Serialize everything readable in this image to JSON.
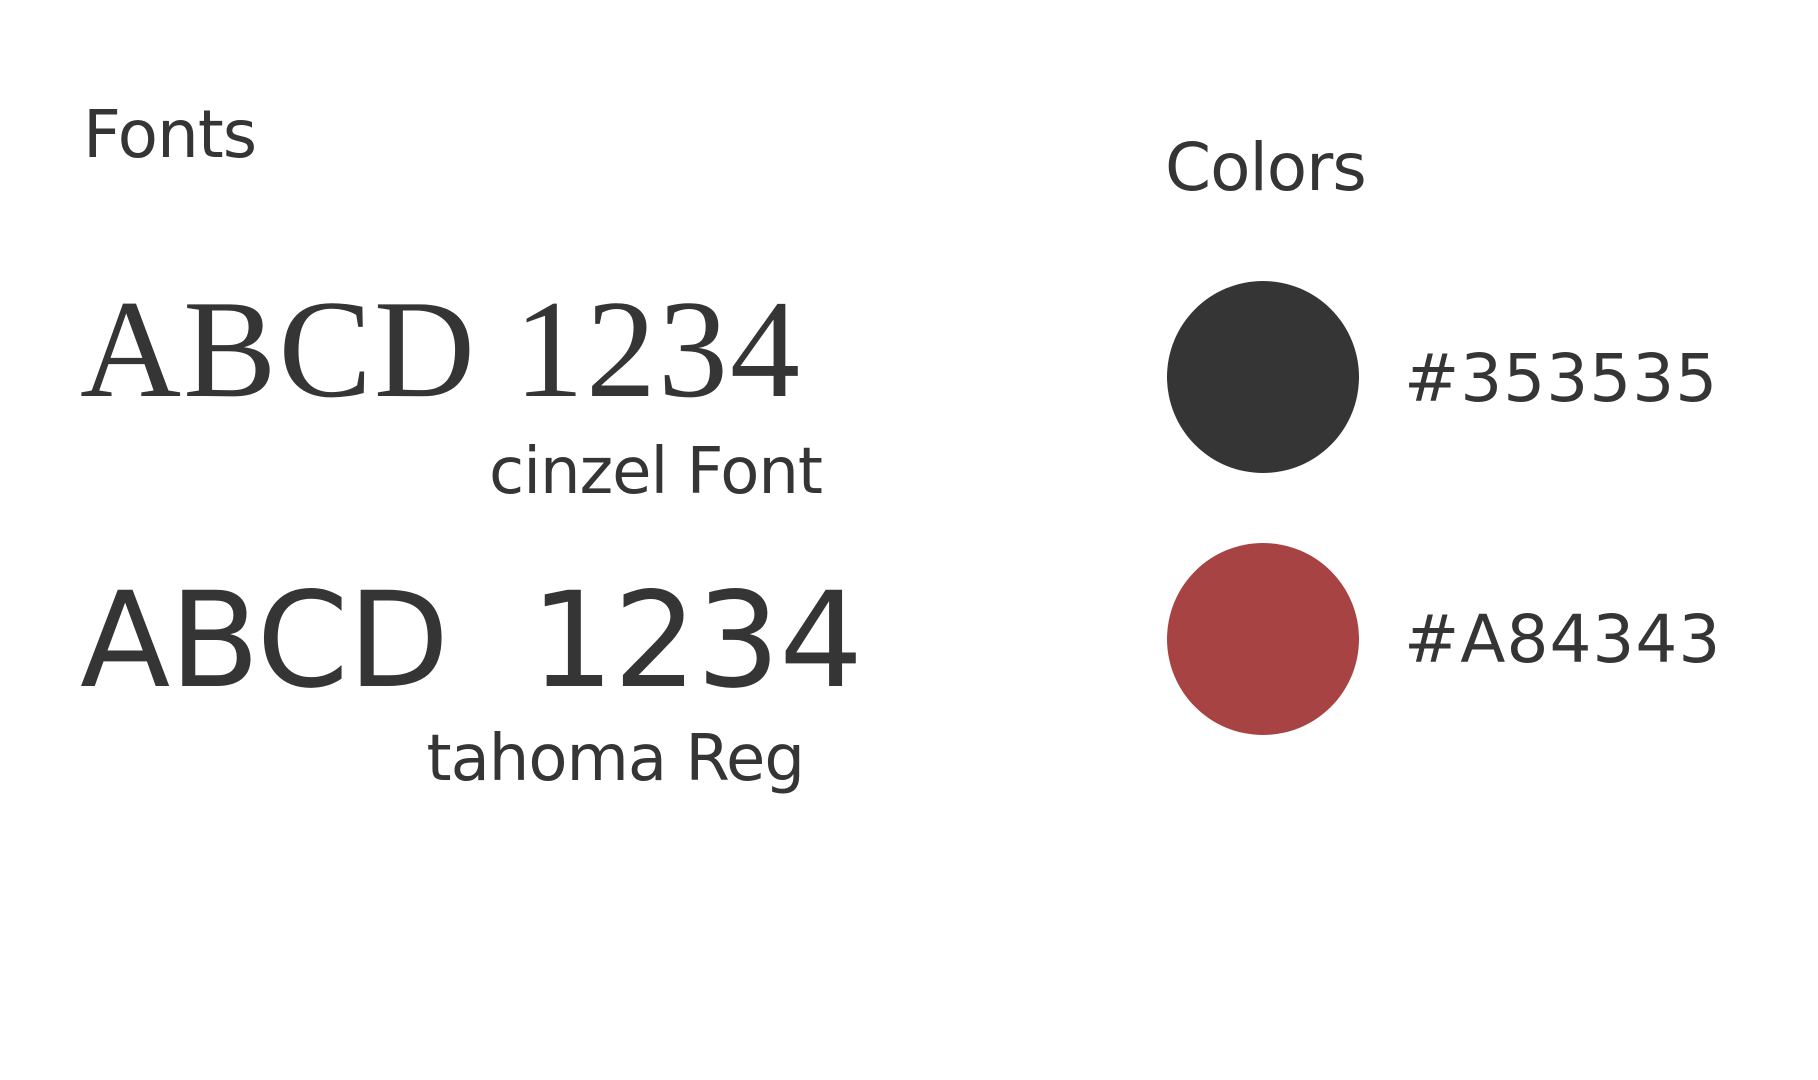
{
  "fonts_section": {
    "title": "Fonts",
    "samples": [
      {
        "text": "ABCD 1234",
        "caption": "cinzel Font"
      },
      {
        "text": "ABCD  1234",
        "caption": "tahoma Reg"
      }
    ]
  },
  "colors_section": {
    "title": "Colors",
    "swatches": [
      {
        "hex": "#353535",
        "color": "#353535"
      },
      {
        "hex": "#A84343",
        "color": "#A84343"
      }
    ]
  }
}
